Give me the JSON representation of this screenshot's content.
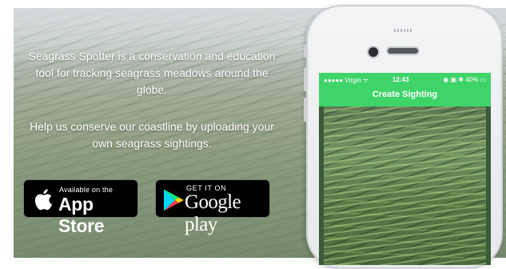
{
  "hero": {
    "tagline": "Seagrass Spotter is a conservation and education tool for tracking seagrass meadows around the globe.",
    "help": "Help us conserve our coastline by uploading your own seagrass sightings."
  },
  "badges": {
    "apple": {
      "small": "Available on the",
      "big": "App Store",
      "icon": "apple-icon"
    },
    "google": {
      "small": "GET IT ON",
      "big": "Google play",
      "icon": "google-play-icon"
    }
  },
  "phone": {
    "status": {
      "carrier": "●●●●● Virgin ᯤ",
      "time": "12:43",
      "right": "◉ ▣ ✱ 40% ▭"
    },
    "nav_title": "Create Sighting",
    "accent": "#3fd46a"
  }
}
